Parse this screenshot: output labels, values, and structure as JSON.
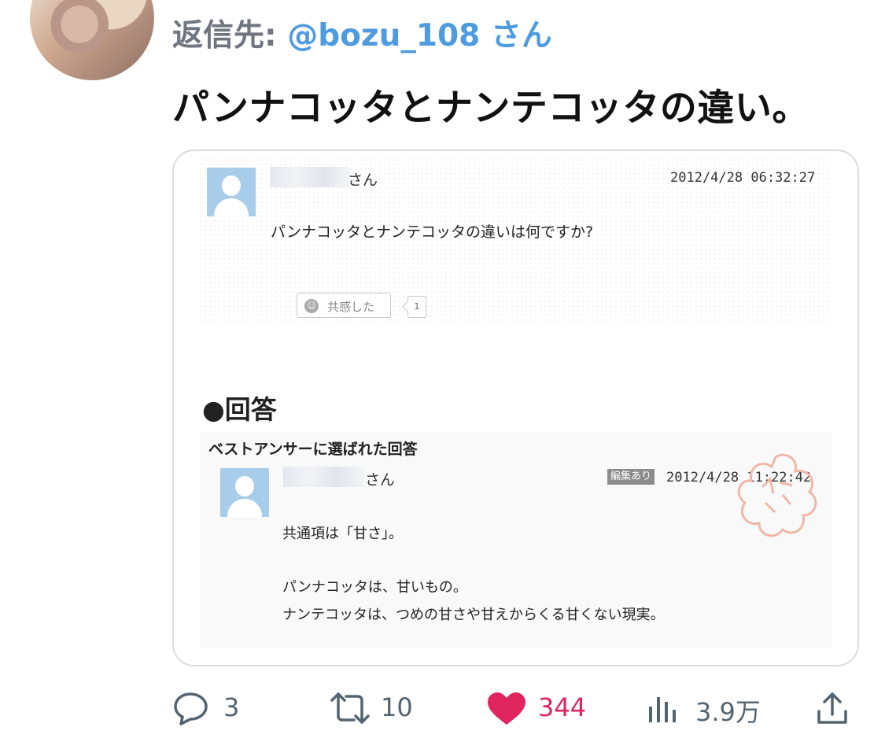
{
  "reply": {
    "prefix": "返信先:",
    "handle": "@bozu_108",
    "suffix": "さん"
  },
  "tweet": {
    "text": "パンナコッタとナンテコッタの違い。"
  },
  "card": {
    "question": {
      "user_suffix": "さん",
      "timestamp": "2012/4/28 06:32:27",
      "text": "パンナコッタとナンテコッタの違いは何ですか?",
      "empathy_label": "共感した",
      "empathy_count": "1"
    },
    "answers_heading": "●回答",
    "best_answer": {
      "label": "ベストアンサーに選ばれた回答",
      "user_suffix": "さん",
      "edited_badge": "編集あり",
      "timestamp": "2012/4/28 11:22:42",
      "lines": [
        "共通項は「甘さ」。",
        "パンナコッタは、甘いもの。",
        "ナンテコッタは、つめの甘さや甘えからくる甘くない現実。"
      ]
    }
  },
  "actions": {
    "replies": "3",
    "retweets": "10",
    "likes": "344",
    "views": "3.9万"
  },
  "icons": [
    "reply-icon",
    "retweet-icon",
    "heart-icon",
    "views-icon",
    "share-icon",
    "user-placeholder-icon",
    "smile-icon",
    "best-answer-stamp-icon"
  ],
  "colors": {
    "handle": "#4f9be0",
    "like": "#e0245e",
    "muted": "#536471"
  }
}
